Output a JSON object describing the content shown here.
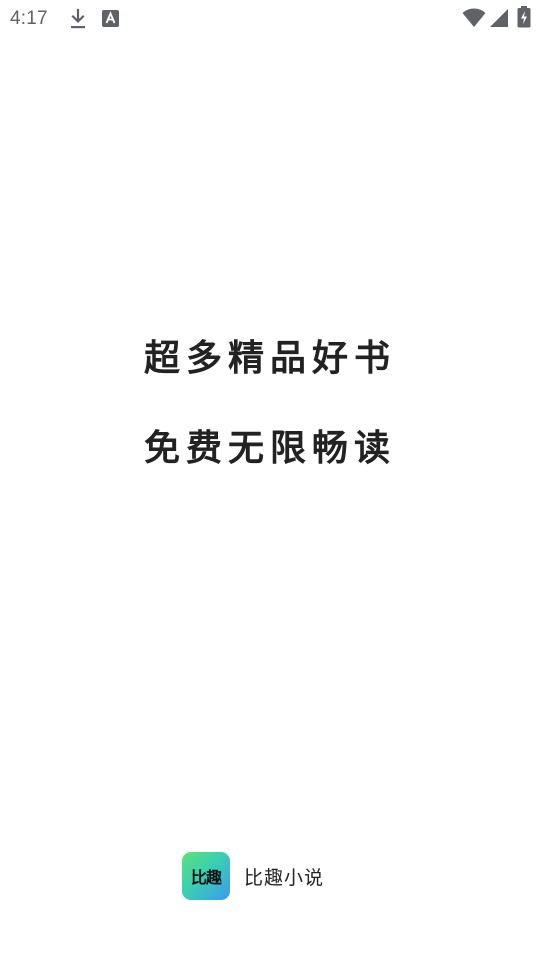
{
  "status_bar": {
    "time": "4:17",
    "icons": [
      "download-icon",
      "app-a-icon",
      "wifi-icon",
      "signal-icon",
      "battery-charging-icon"
    ]
  },
  "slogans": {
    "line1": "超多精品好书",
    "line2": "免费无限畅读"
  },
  "brand": {
    "logo_text": "比趣",
    "app_name": "比趣小说"
  },
  "colors": {
    "text": "#222222",
    "status_gray": "#5f6368",
    "logo_gradient": [
      "#5fe07a",
      "#3ad0b0",
      "#3a9af0"
    ]
  }
}
